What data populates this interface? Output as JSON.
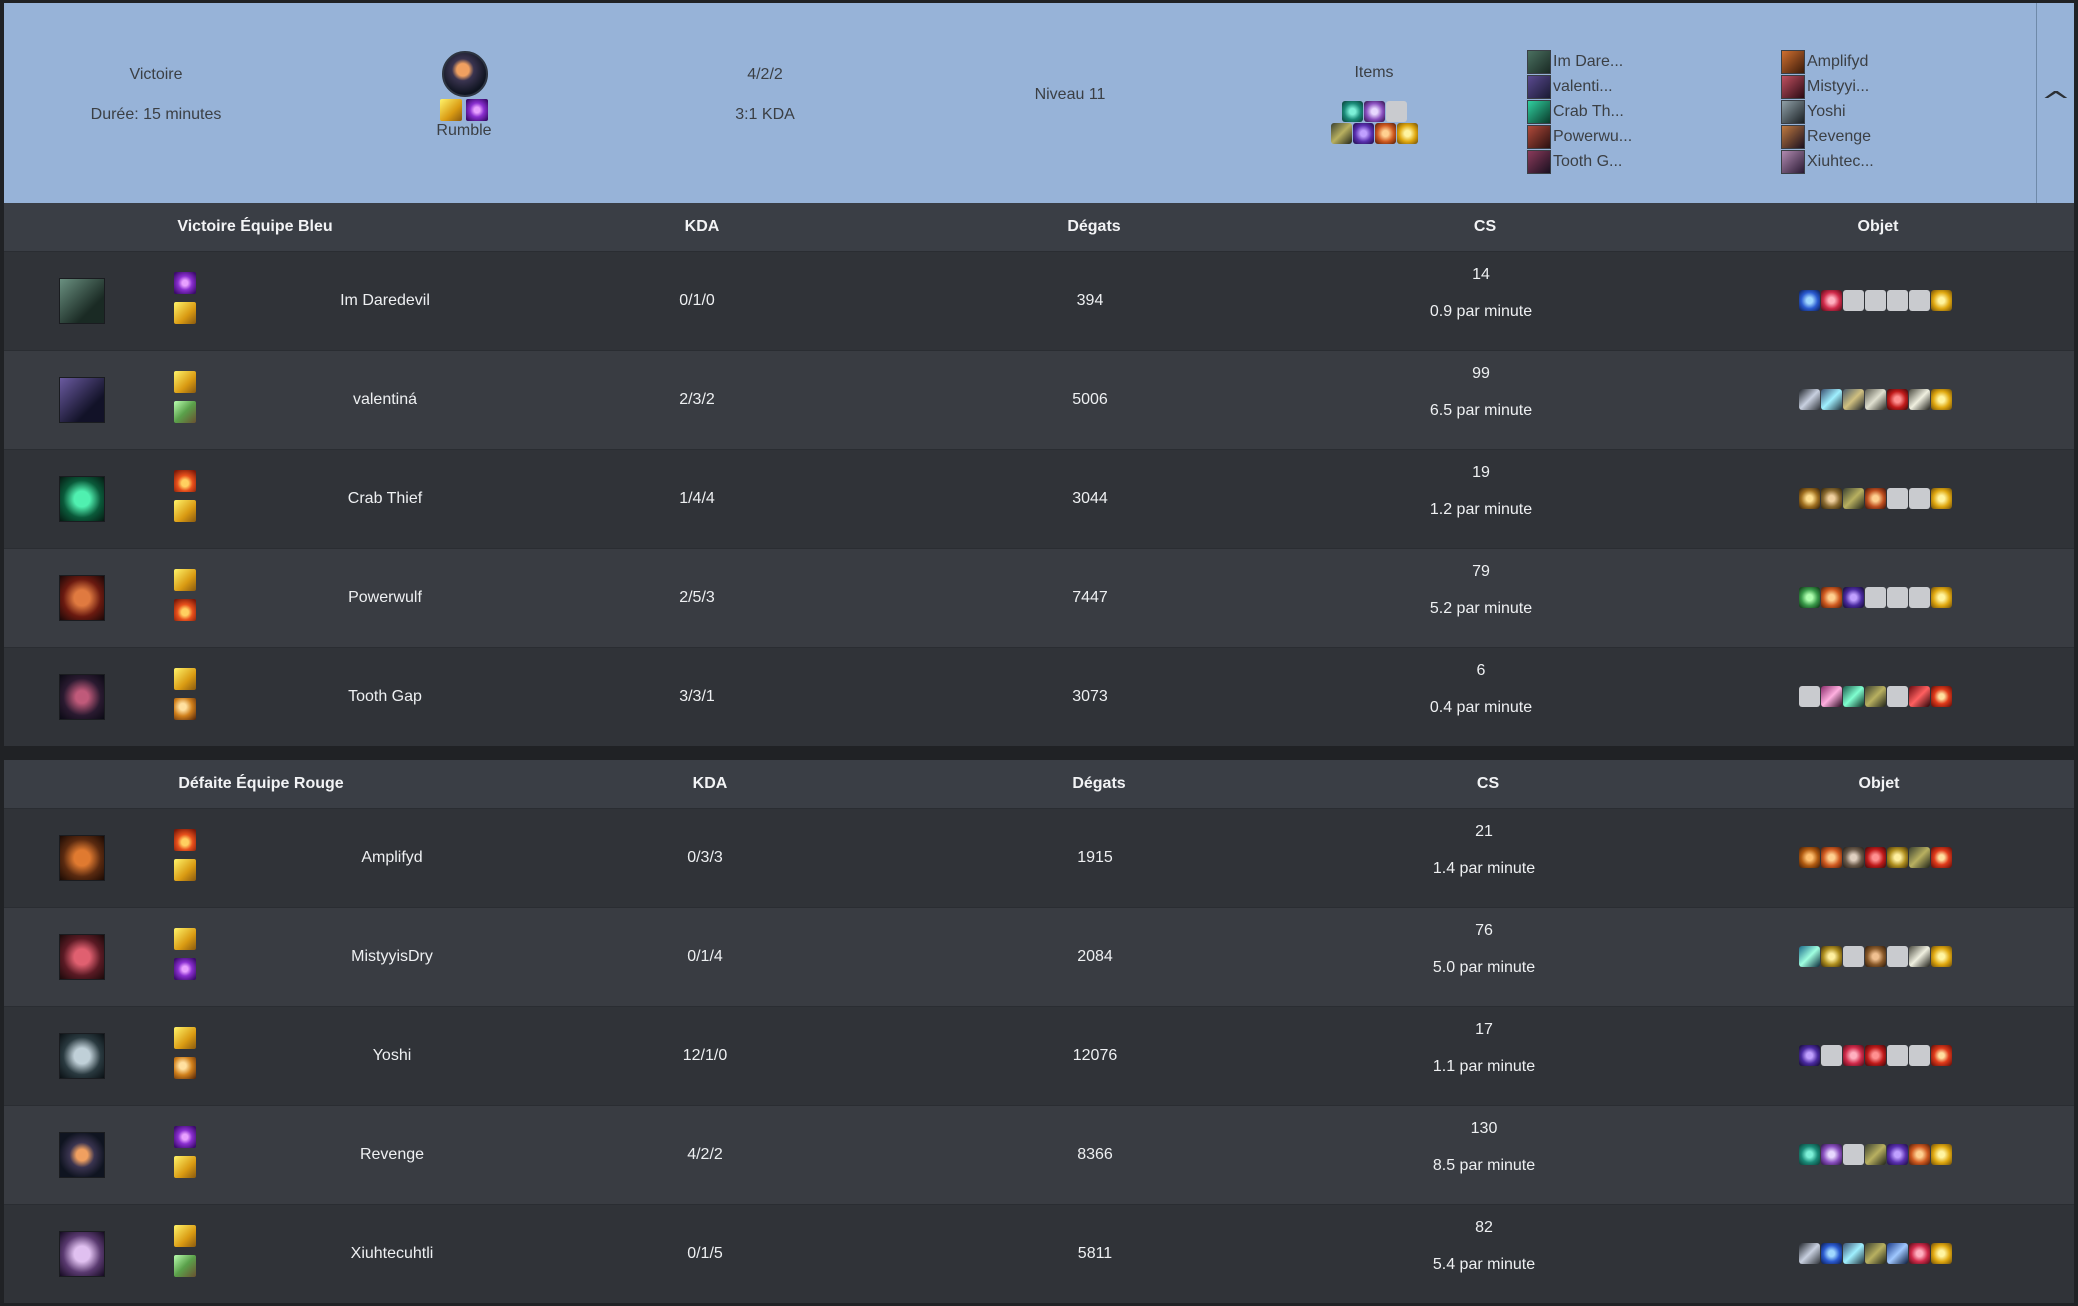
{
  "summary": {
    "result": "Victoire",
    "duration": "Durée: 15 minutes",
    "champion": "Rumble",
    "kda": "4/2/2",
    "kda_ratio": "3:1 KDA",
    "level": "Niveau 11",
    "items_label": "Items",
    "blue_roster": [
      "Im Dare...",
      "valenti...",
      "Crab Th...",
      "Powerwu...",
      "Tooth G..."
    ],
    "red_roster": [
      "Amplifyd",
      "Mistyyi...",
      "Yoshi",
      "Revenge",
      "Xiuhtec..."
    ]
  },
  "colors": {
    "banner": "#97b3d8",
    "background": "#202225",
    "header_row": "#3a3e45",
    "row_odd": "#303338",
    "row_even": "#393c42"
  },
  "teams": [
    {
      "title": "Victoire Équipe Bleu",
      "columns": {
        "kda": "KDA",
        "damage": "Dégats",
        "cs": "CS",
        "items": "Objet"
      },
      "players": [
        {
          "name": "Im Daredevil",
          "kda": "0/1/0",
          "damage": "394",
          "cs": "14",
          "cs_per_min": "0.9 par minute",
          "spells": [
            "teleport",
            "flash"
          ],
          "items": [
            "blue-orb",
            "crimson-gem",
            "empty",
            "empty",
            "empty",
            "empty",
            "gold-ward"
          ]
        },
        {
          "name": "valentiná",
          "kda": "2/3/2",
          "damage": "5006",
          "cs": "99",
          "cs_per_min": "6.5 par minute",
          "spells": [
            "flash",
            "smite"
          ],
          "items": [
            "dagger",
            "spear",
            "rune-blade",
            "sword",
            "blood-shield",
            "long-sword",
            "gold-ward"
          ]
        },
        {
          "name": "Crab Thief",
          "kda": "1/4/4",
          "damage": "3044",
          "cs": "19",
          "cs_per_min": "1.2 par minute",
          "spells": [
            "ignite",
            "flash"
          ],
          "items": [
            "gold-shield",
            "bronze-idol",
            "dark-boots",
            "fire-axe",
            "empty",
            "empty",
            "gold-ward"
          ]
        },
        {
          "name": "Powerwulf",
          "kda": "2/5/3",
          "damage": "7447",
          "cs": "79",
          "cs_per_min": "5.2 par minute",
          "spells": [
            "flash",
            "ignite"
          ],
          "items": [
            "green-tome",
            "fire-orb",
            "void-staff",
            "empty",
            "empty",
            "empty",
            "gold-ward"
          ]
        },
        {
          "name": "Tooth Gap",
          "kda": "3/3/1",
          "damage": "3073",
          "cs": "6",
          "cs_per_min": "0.4 par minute",
          "spells": [
            "flash",
            "ghost"
          ],
          "items": [
            "empty",
            "crossed-blades",
            "emerald-blade",
            "dark-boots",
            "empty",
            "crimson-axe",
            "red-lantern"
          ]
        }
      ]
    },
    {
      "title": "Défaite Équipe Rouge",
      "columns": {
        "kda": "KDA",
        "damage": "Dégats",
        "cs": "CS",
        "items": "Objet"
      },
      "players": [
        {
          "name": "Amplifyd",
          "kda": "0/3/3",
          "damage": "1915",
          "cs": "21",
          "cs_per_min": "1.4 par minute",
          "spells": [
            "ignite",
            "flash"
          ],
          "items": [
            "bronze-claw",
            "fire-orb",
            "stone-boots",
            "blood-shield",
            "gold-idol",
            "dark-boots",
            "red-lantern"
          ]
        },
        {
          "name": "MistyyisDry",
          "kda": "0/1/4",
          "damage": "2084",
          "cs": "76",
          "cs_per_min": "5.0 par minute",
          "spells": [
            "flash",
            "teleport"
          ],
          "items": [
            "cyan-blade",
            "gold-idol",
            "empty",
            "bronze-shield",
            "empty",
            "long-sword",
            "gold-ward"
          ]
        },
        {
          "name": "Yoshi",
          "kda": "12/1/0",
          "damage": "12076",
          "cs": "17",
          "cs_per_min": "1.1 par minute",
          "spells": [
            "flash",
            "ghost"
          ],
          "items": [
            "void-staff",
            "empty",
            "crimson-gem",
            "blood-shield",
            "empty",
            "empty",
            "red-lantern"
          ]
        },
        {
          "name": "Revenge",
          "kda": "4/2/2",
          "damage": "8366",
          "cs": "130",
          "cs_per_min": "8.5 par minute",
          "spells": [
            "teleport",
            "flash"
          ],
          "items": [
            "teal-orb",
            "silver-gem",
            "empty",
            "dark-boots",
            "violet-staff",
            "fire-orb",
            "gold-ward"
          ]
        },
        {
          "name": "Xiuhtecuhtli",
          "kda": "0/1/5",
          "damage": "5811",
          "cs": "82",
          "cs_per_min": "5.4 par minute",
          "spells": [
            "flash",
            "smite"
          ],
          "items": [
            "dagger",
            "blue-orb",
            "spear",
            "dark-boots",
            "blue-blade",
            "crimson-gem",
            "gold-ward"
          ]
        }
      ]
    }
  ]
}
